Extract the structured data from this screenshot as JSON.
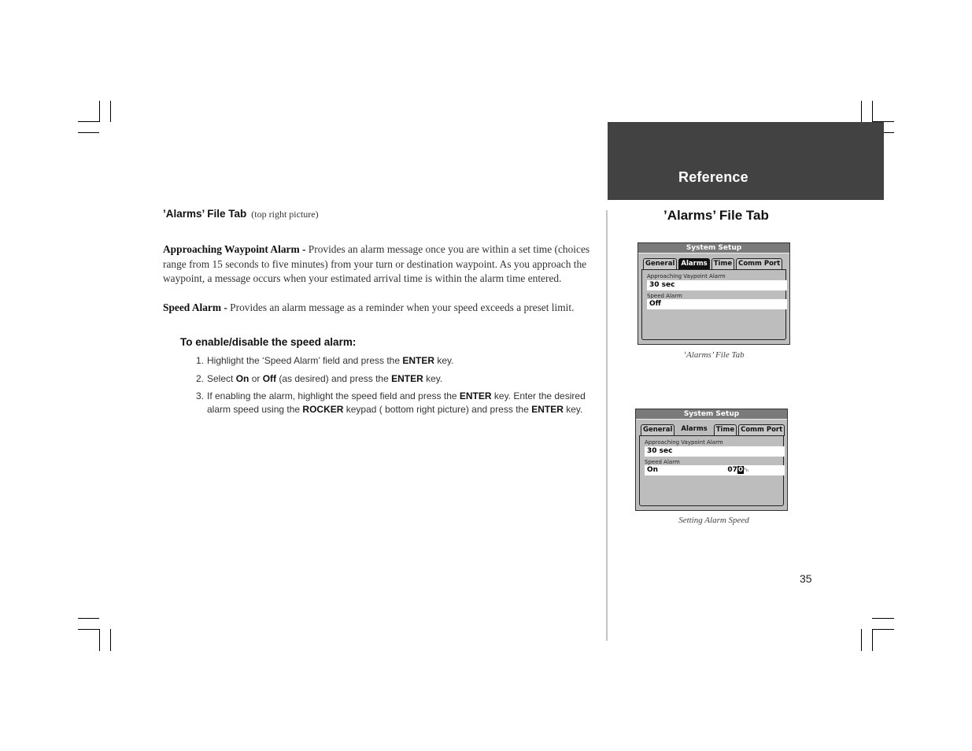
{
  "header": {
    "section": "Reference"
  },
  "left": {
    "section_title": "’Alarms’ File Tab",
    "section_note": "(top right picture)",
    "paragraphs": [
      {
        "term": "Approaching Waypoint Alarm -",
        "text": " Provides an alarm message once you are within a set time (choices range from 15 seconds to five minutes) from your turn or destination waypoint.  As you approach the waypoint, a message occurs when your estimated arrival time is within the alarm time entered."
      },
      {
        "term": "Speed Alarm -",
        "text": " Provides an alarm message as a reminder when your speed exceeds a preset limit."
      }
    ],
    "procedure_title": "To enable/disable the speed alarm:",
    "steps": [
      {
        "num": "1.",
        "parts": [
          "Highlight the ‘Speed Alarm’ field and press the ",
          "ENTER",
          " key."
        ]
      },
      {
        "num": "2.",
        "parts": [
          "Select ",
          "On",
          " or ",
          "Off",
          " (as desired) and press the ",
          "ENTER",
          " key."
        ]
      },
      {
        "num": "3.",
        "parts": [
          "If enabling the alarm, highlight the speed field and press the ",
          "ENTER",
          " key.  Enter the desired alarm speed using the ",
          "ROCKER",
          " keypad ( bottom right picture) and press the ",
          "ENTER",
          " key."
        ]
      }
    ]
  },
  "right": {
    "section_title": "’Alarms’ File Tab",
    "screens": [
      {
        "title": "System Setup",
        "tabs": [
          "General",
          "Alarms",
          "Time",
          "Comm Port"
        ],
        "active_tab": "Alarms",
        "fields": [
          {
            "label": "Approaching Vaypoint Alarm",
            "value": "30 sec"
          },
          {
            "label": "Speed Alarm",
            "value": "Off"
          }
        ],
        "caption": "‘Alarms’ File Tab"
      },
      {
        "title": "System Setup",
        "tabs": [
          "General",
          "Alarms",
          "Time",
          "Comm Port"
        ],
        "active_tab": "Alarms",
        "fields": [
          {
            "label": "Approaching Vaypoint Alarm",
            "value": "30 sec"
          },
          {
            "label": "Speed Alarm",
            "value": "On",
            "speed_prefix": "07",
            "speed_cursor": "0",
            "speed_unit": "ᵏₕ"
          }
        ],
        "caption": "Setting Alarm Speed"
      }
    ]
  },
  "page_number": "35"
}
